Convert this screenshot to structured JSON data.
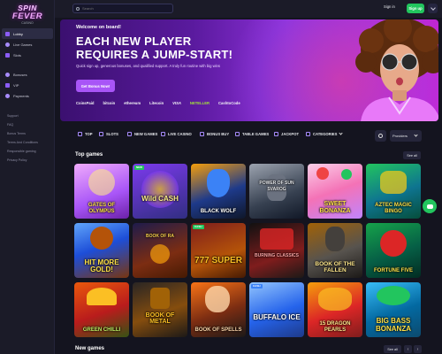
{
  "logo": {
    "line1": "SPIN",
    "line2": "FEVER",
    "line3": "CASINO"
  },
  "sidebar": {
    "items": [
      {
        "label": "Lobby",
        "active": true
      },
      {
        "label": "Live Games"
      },
      {
        "label": "Slots"
      }
    ],
    "items2": [
      {
        "label": "Bonuses"
      },
      {
        "label": "VIP"
      },
      {
        "label": "Payments"
      }
    ],
    "links": [
      "Support",
      "FAQ",
      "Bonus Terms",
      "Terms And Conditions",
      "Responsible gaming",
      "Privacy Policy"
    ]
  },
  "topbar": {
    "search_placeholder": "Search",
    "signin": "Sign in",
    "signup": "Sign up"
  },
  "hero": {
    "welcome": "Welcome on board!",
    "headline_1": "EACH NEW PLAYER",
    "headline_2": "REQUIRES A JUMP-START!",
    "subtitle": "Quick sign up, generous bonuses, and qualified support. A truly fun routine with big wins",
    "cta": "Get Bonus Now!",
    "payments": [
      "CoinsPaid",
      "bitcoin",
      "ethereum",
      "Litecoin",
      "VISA",
      "NETELLER",
      "CashtoCode"
    ]
  },
  "categories": [
    "TOP",
    "SLOTS",
    "NEW GAMES",
    "LIVE CASINO",
    "BONUS BUY",
    "TABLE GAMES",
    "JACKPOT",
    "CATEGORIES"
  ],
  "providers_label": "Providers",
  "top_games": {
    "title": "Top games",
    "see_all": "See all",
    "games": [
      {
        "name": "GATES OF OLYMPUS",
        "badge": ""
      },
      {
        "name": "Wild CASH",
        "badge": "NEW"
      },
      {
        "name": "BLACK WOLF",
        "badge": ""
      },
      {
        "name": "POWER OF SUN SVAROG",
        "badge": ""
      },
      {
        "name": "SWEET BONANZA",
        "badge": ""
      },
      {
        "name": "AZTEC MAGIC BINGO",
        "badge": ""
      },
      {
        "name": "HIT MORE GOLD!",
        "badge": ""
      },
      {
        "name": "BOOK OF RA",
        "badge": ""
      },
      {
        "name": "777 SUPER",
        "badge": "CASH"
      },
      {
        "name": "BURNING CLASSICS",
        "badge": ""
      },
      {
        "name": "BOOK OF THE FALLEN",
        "badge": ""
      },
      {
        "name": "FORTUNE FIVE",
        "badge": ""
      },
      {
        "name": "GREEN CHILLI",
        "badge": ""
      },
      {
        "name": "BOOK OF METAL",
        "badge": ""
      },
      {
        "name": "BOOK OF SPELLS",
        "badge": ""
      },
      {
        "name": "BUFFALO ICE",
        "badge": "CASH"
      },
      {
        "name": "15 DRAGON PEARLS",
        "badge": ""
      },
      {
        "name": "BIG BASS BONANZA",
        "badge": ""
      }
    ]
  },
  "new_games": {
    "title": "New games",
    "see_all": "See all"
  },
  "colors": {
    "accent": "#a855f7",
    "signup": "#22c55e",
    "bg": "#14141f"
  }
}
